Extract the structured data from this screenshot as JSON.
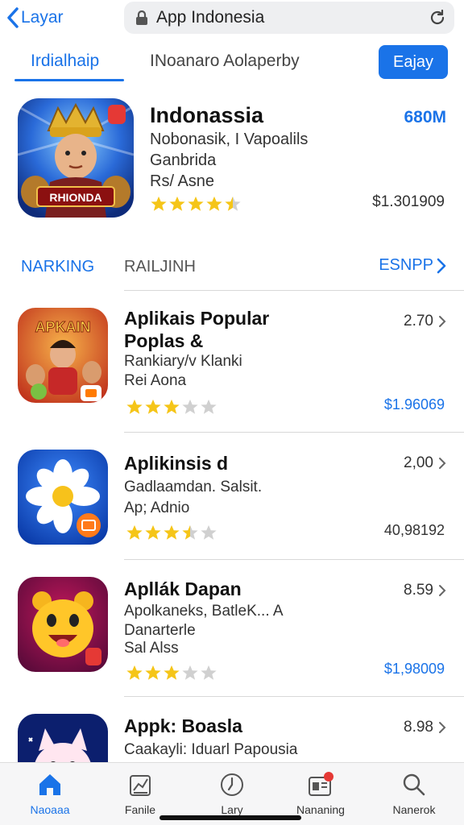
{
  "topbar": {
    "back_label": "Layar",
    "url": "App Indonesia",
    "icons": [
      "chevron-left-icon",
      "lock-icon",
      "reload-icon"
    ]
  },
  "tabs": {
    "active": "Irdialhaip",
    "second": "INoanaro Aolaperby",
    "button": "Eajay"
  },
  "featured": {
    "title": "Indonassia",
    "line1": "Nobonasik, I Vapoalils",
    "line2": "Ganbrida",
    "line3": "Rs/ Asne",
    "size": "680M",
    "price": "$1.301909",
    "rating": 4.5,
    "icon_label": "RHIONDA"
  },
  "section": {
    "left": "NARKING",
    "middle": "RAILJINH",
    "right": "ESNPP"
  },
  "apps": [
    {
      "title": "Aplikais Popular",
      "title2": "Poplas &",
      "line1": "Rankiary/v Klanki",
      "line2": "Rei Aona",
      "num": "2.70",
      "price": "$1.96069",
      "price_color": "#1a73e8",
      "rating": 3,
      "icon_label": "APKAIN"
    },
    {
      "title": "Aplikinsis d",
      "title2": "",
      "line1": "Gadlaamdan. Salsit.",
      "line2": "Ap; Adnio",
      "num": "2,00",
      "price": "40,98192",
      "price_color": "#333333",
      "rating": 3.5,
      "icon_label": ""
    },
    {
      "title": "Apllák Dapan",
      "title2": "",
      "line1": "Apolkaneks, BatleK... A",
      "line2": "Danarterle",
      "line3": "Sal Alss",
      "num": "8.59",
      "price": "$1,98009",
      "price_color": "#1a73e8",
      "rating": 3,
      "icon_label": ""
    },
    {
      "title": "Appk: Boasla",
      "title2": "",
      "line1": "Caakayli: Iduarl Papousia",
      "line2": "",
      "num": "8.98",
      "price": "",
      "price_color": "#333333",
      "rating": 0,
      "icon_label": ""
    }
  ],
  "nav": [
    {
      "label": "Naoaaa",
      "icon": "home-icon",
      "active": true
    },
    {
      "label": "Fanile",
      "icon": "chart-icon",
      "active": false
    },
    {
      "label": "Lary",
      "icon": "clock-icon",
      "active": false
    },
    {
      "label": "Nananing",
      "icon": "ranking-icon",
      "active": false
    },
    {
      "label": "Nanerok",
      "icon": "search-icon",
      "active": false
    }
  ],
  "colors": {
    "accent": "#1a73e8",
    "star": "#f5c518",
    "star_empty": "#d0d0d0"
  }
}
